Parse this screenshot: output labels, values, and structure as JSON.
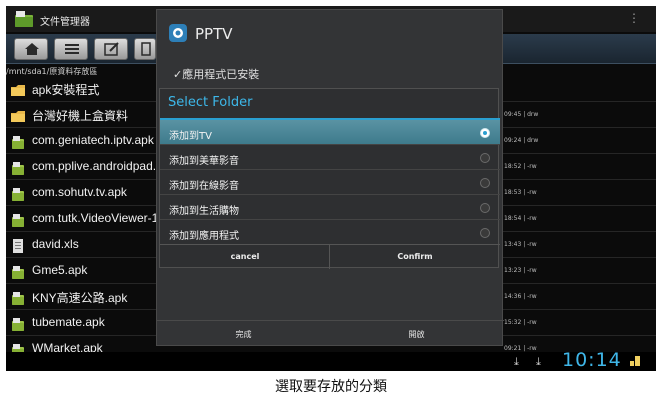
{
  "app": {
    "title": "文件管理器"
  },
  "path": "/mnt/sda1/原資料存放區",
  "files": [
    {
      "name": "apk安裝程式",
      "meta": "",
      "type": "folder"
    },
    {
      "name": "台灣好機上盒資料",
      "meta": "09:45 | drw",
      "type": "folder"
    },
    {
      "name": "com.geniatech.iptv.apk",
      "meta": "09:24 | drw",
      "type": "apk"
    },
    {
      "name": "com.pplive.androidpad.",
      "meta": "18:52 | -rw",
      "type": "apk"
    },
    {
      "name": "com.sohutv.tv.apk",
      "meta": "18:53 | -rw",
      "type": "apk"
    },
    {
      "name": "com.tutk.VideoViewer-1",
      "meta": "18:54 | -rw",
      "type": "apk"
    },
    {
      "name": "david.xls",
      "meta": "13:43 | -rw",
      "type": "doc"
    },
    {
      "name": "Gme5.apk",
      "meta": "13:23 | -rw",
      "type": "apk"
    },
    {
      "name": "KNY高速公路.apk",
      "meta": "14:36 | -rw",
      "type": "apk"
    },
    {
      "name": "tubemate.apk",
      "meta": "15:32 | -rw",
      "type": "apk"
    },
    {
      "name": "WMarket.apk",
      "meta": "09:21 | -rw",
      "type": "apk"
    }
  ],
  "pptv": {
    "title": "PPTV",
    "installed": "✓應用程式已安裝",
    "done_label": "完成",
    "open_label": "開啟"
  },
  "folder_dialog": {
    "title": "Select Folder",
    "options": [
      {
        "label": "添加到TV",
        "selected": true
      },
      {
        "label": "添加到美華影音",
        "selected": false
      },
      {
        "label": "添加到在線影音",
        "selected": false
      },
      {
        "label": "添加到生活購物",
        "selected": false
      },
      {
        "label": "添加到應用程式",
        "selected": false
      }
    ],
    "cancel_label": "cancel",
    "confirm_label": "Confirm"
  },
  "statusbar": {
    "clock": "10:14"
  },
  "caption": "選取要存放的分類",
  "colors": {
    "accent": "#3db8ea",
    "selected_row": "#4f8c9c"
  }
}
